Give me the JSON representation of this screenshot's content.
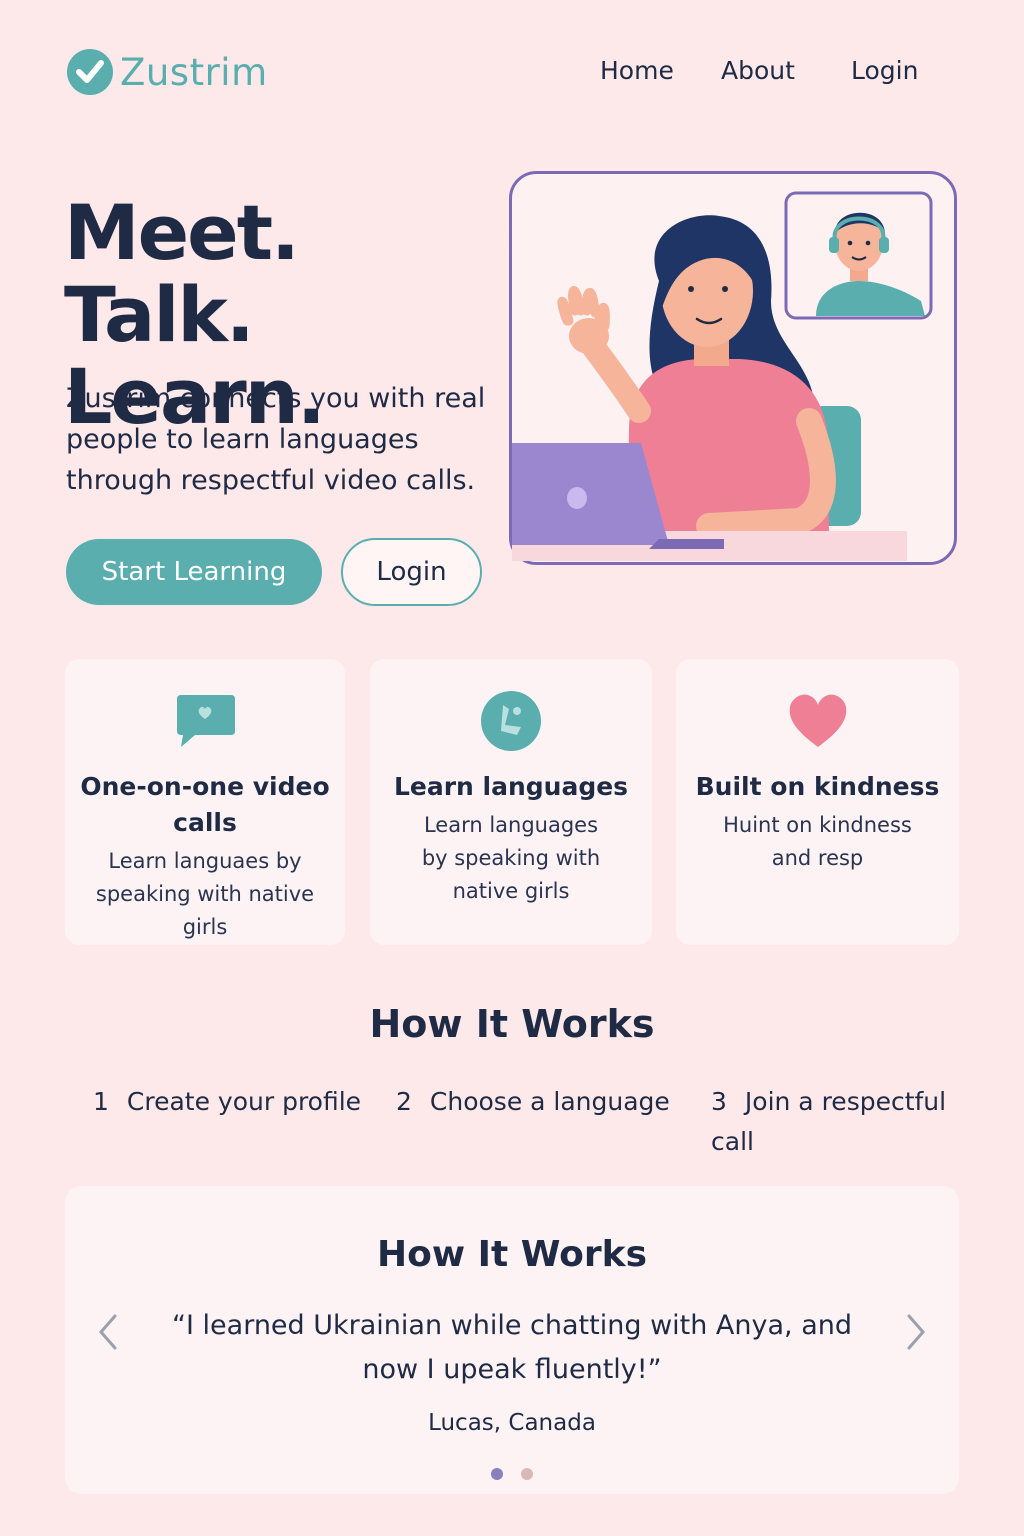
{
  "brand": {
    "name": "Zustrim"
  },
  "nav": {
    "home": "Home",
    "about": "About",
    "login": "Login"
  },
  "hero": {
    "title_line1": "Meet. Talk.",
    "title_line2": "Learn.",
    "subtitle": "Zustrim connects you with real people to learn languages through respectful video calls.",
    "primary_button": "Start Learning",
    "secondary_button": "Login"
  },
  "features": [
    {
      "title": "One-on-one video calls",
      "text": "Learn languaes by speaking with native girls",
      "icon": "chat-bubble-heart-icon"
    },
    {
      "title": "Learn languages",
      "text": "Learn languages by speaking with native girls",
      "icon": "language-badge-icon"
    },
    {
      "title": "Built on kindness",
      "text": "Huint on kindness and resp",
      "icon": "heart-icon"
    }
  ],
  "how_it_works": {
    "title": "How It Works",
    "steps": [
      {
        "num": "1",
        "label": "Create your profile"
      },
      {
        "num": "2",
        "label": "Choose a language"
      },
      {
        "num": "3",
        "label": "Join a respectful call"
      }
    ]
  },
  "testimonial": {
    "title": "How It Works",
    "quote": "“I learned Ukrainian while chatting with Anya, and now I upeak fluently!”",
    "author": "Lucas, Canada",
    "active_slide": 1,
    "slide_count": 2
  },
  "colors": {
    "background": "#fde8ea",
    "accent_teal": "#5aaeae",
    "navy": "#1f2a44",
    "purple": "#7b6bb5",
    "pink": "#ef7f95"
  }
}
